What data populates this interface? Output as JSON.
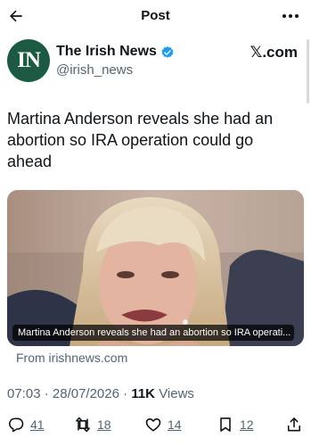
{
  "header": {
    "title": "Post",
    "back_icon": "back-arrow-icon",
    "more_icon": "more-dots-icon"
  },
  "author": {
    "avatar_text": "IN",
    "name": "The Irish News",
    "handle": "@irish_news",
    "verified_color": "#1d9bf0",
    "brand_color": "#1c5a43",
    "platform_label": "𝕏.com"
  },
  "tweet": {
    "text": "Martina Anderson reveals she had an abortion so IRA operation could go ahead"
  },
  "card": {
    "caption": "Martina Anderson reveals she had an abortion so IRA operati...",
    "source": "From irishnews.com"
  },
  "meta": {
    "time": "07:03",
    "date": "28/07/2026",
    "views_count": "11K",
    "views_label": "Views"
  },
  "actions": {
    "replies": "41",
    "reposts": "18",
    "likes": "14",
    "bookmarks": "12"
  }
}
